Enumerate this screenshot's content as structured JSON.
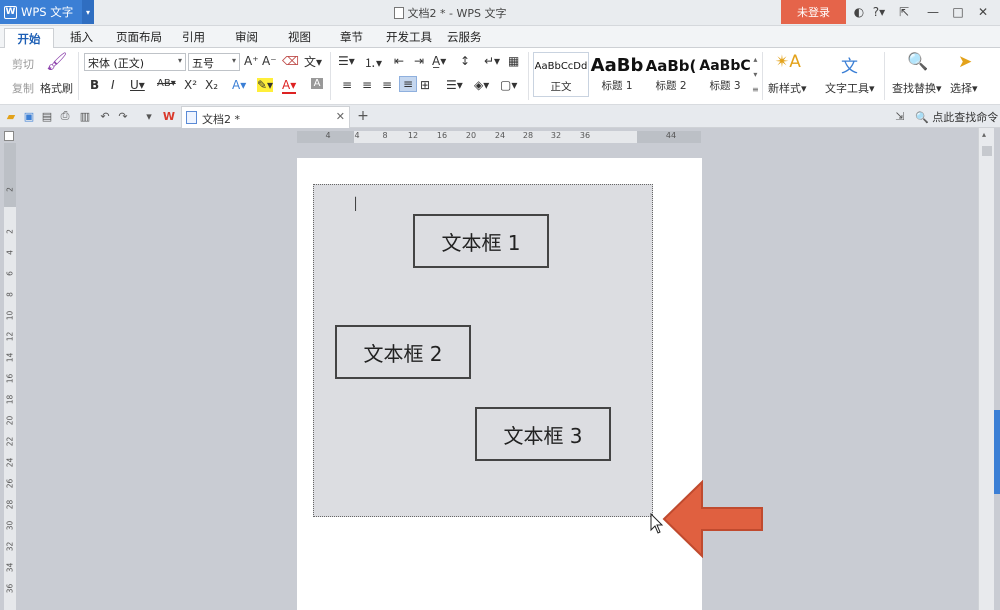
{
  "titlebar": {
    "app_name": "WPS 文字",
    "app_logo_letter": "W",
    "window_title": "文档2 * - WPS 文字",
    "login_label": "未登录",
    "login_color": "#e5644a",
    "app_color": "#3b7fd5"
  },
  "menu": {
    "tabs": [
      "开始",
      "插入",
      "页面布局",
      "引用",
      "审阅",
      "视图",
      "章节",
      "开发工具",
      "云服务"
    ]
  },
  "ribbon": {
    "clipboard": {
      "cut": "剪切",
      "copy": "复制",
      "format_painter": "格式刷"
    },
    "font": {
      "family": "宋体 (正文)",
      "size": "五号"
    },
    "styles": [
      {
        "sample": "AaBbCcDd",
        "name": "正文"
      },
      {
        "sample": "AaBb",
        "name": "标题 1"
      },
      {
        "sample": "AaBb(",
        "name": "标题 2"
      },
      {
        "sample": "AaBbC",
        "name": "标题 3"
      }
    ],
    "new_style": "新样式",
    "text_tools": "文字工具",
    "find_replace": "查找替换",
    "select": "选择"
  },
  "quickaccess": {
    "doc_tab": "文档2 *",
    "search_command": "点此查找命令"
  },
  "ruler": {
    "h_ticks": [
      "4",
      "4",
      "8",
      "12",
      "16",
      "20",
      "24",
      "28",
      "32",
      "36",
      "44"
    ],
    "v_ticks": [
      "2",
      "2",
      "4",
      "6",
      "8",
      "10",
      "12",
      "14",
      "16",
      "18",
      "20",
      "22",
      "24",
      "26",
      "28",
      "30",
      "32",
      "34",
      "36"
    ]
  },
  "document": {
    "textboxes": [
      "文本框 1",
      "文本框 2",
      "文本框 3"
    ],
    "arrow_color": "#e06040"
  }
}
